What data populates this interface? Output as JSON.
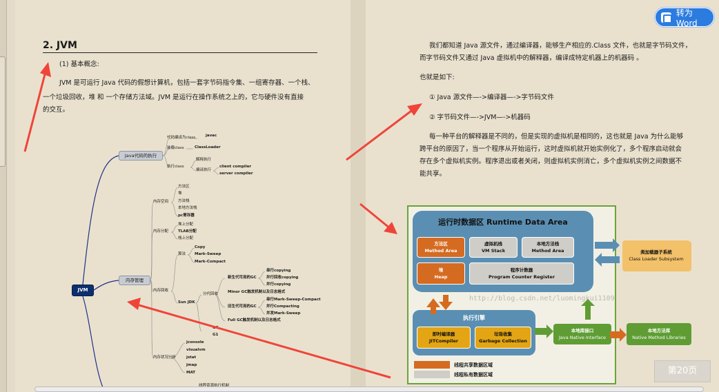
{
  "toolbar": {
    "convert_word_label": "转为Word"
  },
  "page_badge": "第20页",
  "left": {
    "heading": "2. JVM",
    "subheading": "(1) 基本概念:",
    "paragraph_lines": [
      "JVM 是可运行 Java 代码的假想计算机，包括一套字节码指令集、一组寄存器、一个栈、",
      "一个垃圾回收，堆 和 一个存储方法域。JVM 是运行在操作系统之上的，它与硬件没有直接",
      "的交互。"
    ],
    "mindmap": {
      "root": "JVM",
      "exec_node": "Java代码的执行",
      "exec_items": [
        "代码编译为class",
        "装载class",
        "执行class"
      ],
      "exec_leaves": [
        "javac",
        "ClassLoader",
        "解释执行",
        "编译执行",
        "client compiler",
        "server compiler"
      ],
      "mem_node": "内存管理",
      "mem_groups": [
        "内存空间",
        "内存分配",
        "内存回收",
        "内存状况分析"
      ],
      "mem_space": [
        "方法区",
        "堆",
        "方法栈",
        "本地方法栈",
        "pc寄存器"
      ],
      "mem_alloc": [
        "堆上分配",
        "TLAB分配",
        "栈上分配"
      ],
      "gc_algo": "算法",
      "gc_algos": [
        "Copy",
        "Mark-Sweep",
        "Mark-Compact"
      ],
      "sun_jdk": "Sun JDK",
      "gen_gc": "分代回收",
      "young_gc": "新生代可用的GC",
      "young_items": [
        "串行copying",
        "并行回收copying",
        "并行copying"
      ],
      "minor_gc": "Minor GC触发机制以及日志格式",
      "old_gc": "旧生代可用的GC",
      "old_items": [
        "串行Mark-Sweep-Compact",
        "并行Compacting",
        "并发Mark-Sweep"
      ],
      "full_gc": "Full GC触发机制以及日志格式",
      "gc_tail": [
        "GC",
        "G1"
      ],
      "analysis": [
        "jconsole",
        "visualvm",
        "jstat",
        "jmap",
        "MAT"
      ],
      "cut_text": "线程资源执行机制"
    }
  },
  "right": {
    "paragraph1": [
      "我们都知道 Java 源文件，通过编译器，能够生产相应的.Class 文件，也就是字节码文件，",
      "而字节码文件又通过 Java 虚拟机中的解释器，编译成特定机器上的机器码 。"
    ],
    "also": "也就是如下:",
    "step1": "① Java 源文件—->编译器—->字节码文件",
    "step2": "② 字节码文件—->JVM—->机器码",
    "paragraph2": [
      "每一种平台的解释器是不同的，但是实现的虚拟机是相同的，这也就是 Java 为什么能够",
      "跨平台的原因了，当一个程序从开始运行，这时虚拟机就开始实例化了，多个程序启动就会",
      "存在多个虚拟机实例。程序退出或者关闭，则虚拟机实例消亡，多个虚拟机实例之间数据不",
      "能共享。"
    ],
    "diagram": {
      "title": "运行时数据区  Runtime Data Area",
      "method_area": [
        "方法区",
        "Method Area"
      ],
      "vm_stack": [
        "虚拟机栈",
        "VM Stack"
      ],
      "native_stack": [
        "本地方法栈",
        "Method Area"
      ],
      "heap": [
        "堆",
        "Heap"
      ],
      "pc": [
        "程序计数器",
        "Program Counter Register"
      ],
      "class_loader": [
        "类加载器子系统",
        "Class Loader Subsystem"
      ],
      "engine_title": "执行引擎",
      "jit": [
        "即时编译器",
        "JITCompiler"
      ],
      "gc": [
        "垃圾收集",
        "Garbage Collection"
      ],
      "native_interface": [
        "本地库接口",
        "Java Native Interface"
      ],
      "native_libs": [
        "本地方法库",
        "Native Method Libraries"
      ],
      "legend_shared": "线程共享数据区域",
      "legend_private": "线程私有数据区域",
      "watermark": "http://blog.csdn.net/luomingkui1109"
    }
  },
  "colors": {
    "annotation_arrow": "#f0443a",
    "button_blue": "#2c7ce0"
  }
}
